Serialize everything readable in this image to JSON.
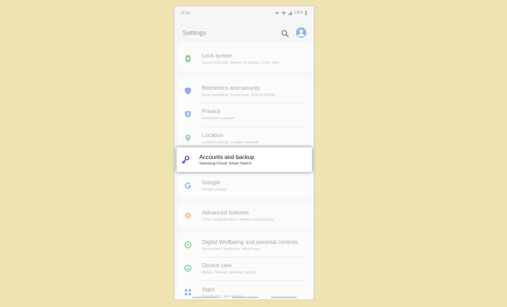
{
  "status_bar": {
    "time": "9:54",
    "battery": "16%"
  },
  "header": {
    "title": "Settings"
  },
  "colors": {
    "background": "#efe3b0",
    "highlight": "#ffffff",
    "accent": "#8fb5ea"
  },
  "items": [
    {
      "title": "Lock screen",
      "subtitle": "Screen lock type, Always On Display, Clock style",
      "icon": "lock-screen-icon"
    },
    {
      "title": "Biometrics and security",
      "subtitle": "Face recognition, Fingerprints, Find My Mobile",
      "icon": "shield-icon"
    },
    {
      "title": "Privacy",
      "subtitle": "Permission manager",
      "icon": "privacy-shield-icon"
    },
    {
      "title": "Location",
      "subtitle": "Location settings, Location requests",
      "icon": "location-pin-icon"
    },
    {
      "title": "Accounts and backup",
      "subtitle": "Samsung Cloud, Smart Switch",
      "icon": "key-icon"
    },
    {
      "title": "Google",
      "subtitle": "Google settings",
      "icon": "google-icon"
    },
    {
      "title": "Advanced features",
      "subtitle": "S Pen, Bixby Routines, Motions and gestures",
      "icon": "gear-plus-icon"
    },
    {
      "title": "Digital Wellbeing and parental controls",
      "subtitle": "Screen time, App timers, Wind Down",
      "icon": "wellbeing-icon"
    },
    {
      "title": "Device care",
      "subtitle": "Battery, Storage, Memory, Security",
      "icon": "device-care-icon"
    },
    {
      "title": "Apps",
      "subtitle": "Default apps, App settings",
      "icon": "apps-grid-icon"
    }
  ]
}
